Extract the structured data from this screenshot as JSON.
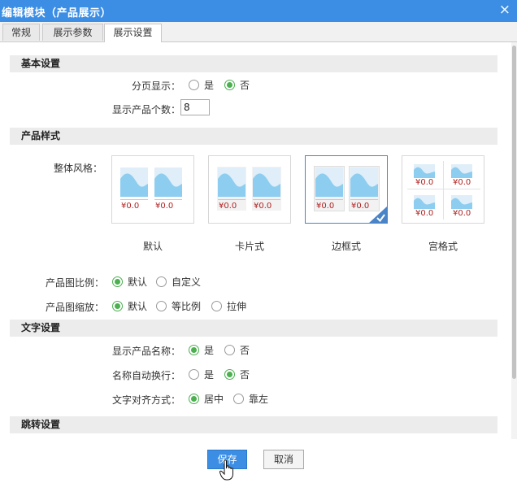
{
  "window": {
    "title": "编辑模块（产品展示）",
    "close_glyph": "×"
  },
  "tabs": [
    {
      "label": "常规"
    },
    {
      "label": "展示参数"
    },
    {
      "label": "展示设置",
      "active": true
    }
  ],
  "basic": {
    "section_title": "基本设置",
    "paging": {
      "label": "分页显示：",
      "options": [
        "是",
        "否"
      ],
      "selected": "否"
    },
    "count": {
      "label": "显示产品个数：",
      "value": "8"
    }
  },
  "style": {
    "section_title": "产品样式",
    "label": "整体风格：",
    "price_text": "¥0.0",
    "options": [
      "默认",
      "卡片式",
      "边框式",
      "宫格式"
    ],
    "selected": "边框式",
    "accent_color": "#4a84c8",
    "image_color": "#8dcdf0",
    "price_color": "#b22222"
  },
  "ratio": {
    "label": "产品图比例：",
    "options": [
      "默认",
      "自定义"
    ],
    "selected": "默认"
  },
  "scale": {
    "label": "产品图缩放：",
    "options": [
      "默认",
      "等比例",
      "拉伸"
    ],
    "selected": "默认"
  },
  "text": {
    "section_title": "文字设置",
    "show_name": {
      "label": "显示产品名称：",
      "options": [
        "是",
        "否"
      ],
      "selected": "是"
    },
    "wrap": {
      "label": "名称自动换行：",
      "options": [
        "是",
        "否"
      ],
      "selected": "否"
    },
    "align": {
      "label": "文字对齐方式：",
      "options": [
        "居中",
        "靠左"
      ],
      "selected": "居中"
    }
  },
  "jump": {
    "section_title": "跳转设置"
  },
  "footer": {
    "save_label": "保存",
    "cancel_label": "取消"
  },
  "colors": {
    "titlebar": "#3b8ee4",
    "radio_checked": "#4caf50"
  }
}
